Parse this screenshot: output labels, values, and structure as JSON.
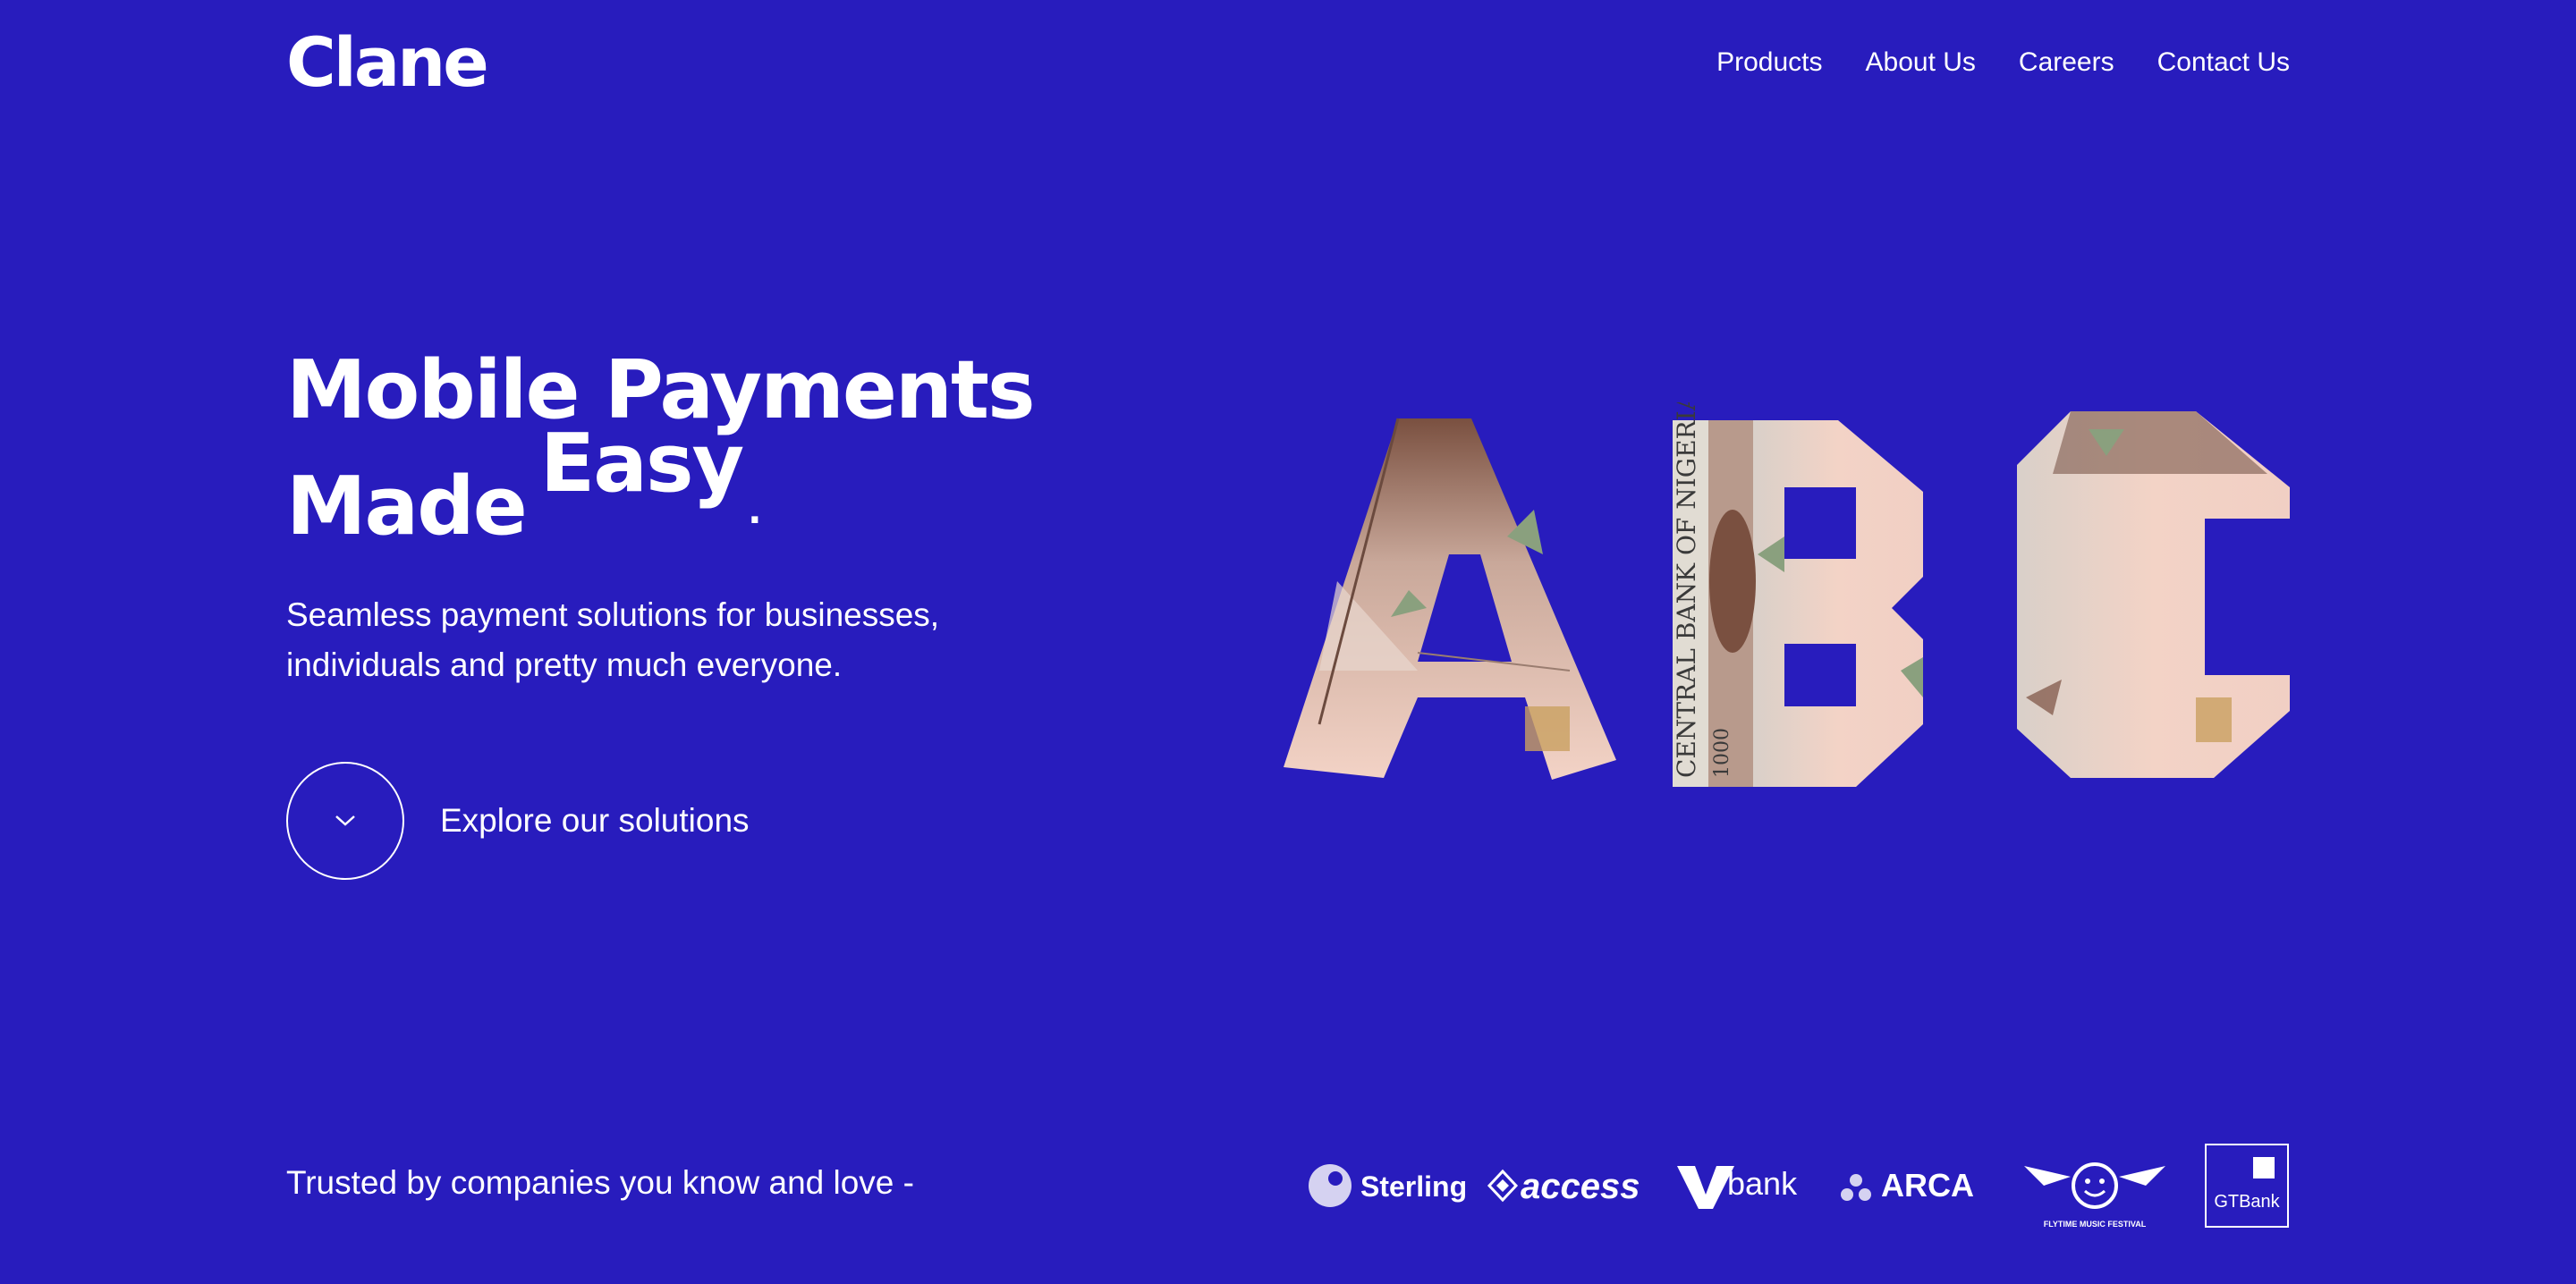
{
  "header": {
    "logo": "Clane",
    "nav": [
      "Products",
      "About Us",
      "Careers",
      "Contact Us"
    ]
  },
  "hero": {
    "title_line1": "Mobile Payments",
    "title_made": "Made",
    "title_easy": "Easy",
    "title_dot": ".",
    "subtitle": "Seamless payment solutions for businesses, individuals and pretty much everyone.",
    "explore_label": "Explore our solutions",
    "explore_icon": "chevron-down-icon",
    "artwork_letters": [
      "A",
      "B",
      "C"
    ],
    "banknote_text": "CENTRAL BANK OF NIGERIA",
    "banknote_value": "1000"
  },
  "trusted": {
    "label": "Trusted by companies you know and love -",
    "partners": [
      "Sterling",
      "access",
      "bank",
      "ARCA",
      "FLYTIME MUSIC FESTIVAL",
      "GTBank"
    ]
  },
  "colors": {
    "background": "#281cbd",
    "text": "#ffffff",
    "banknote_pink": "#f3d3c6",
    "banknote_brown": "#7a5040",
    "banknote_green": "#8aa07e"
  }
}
